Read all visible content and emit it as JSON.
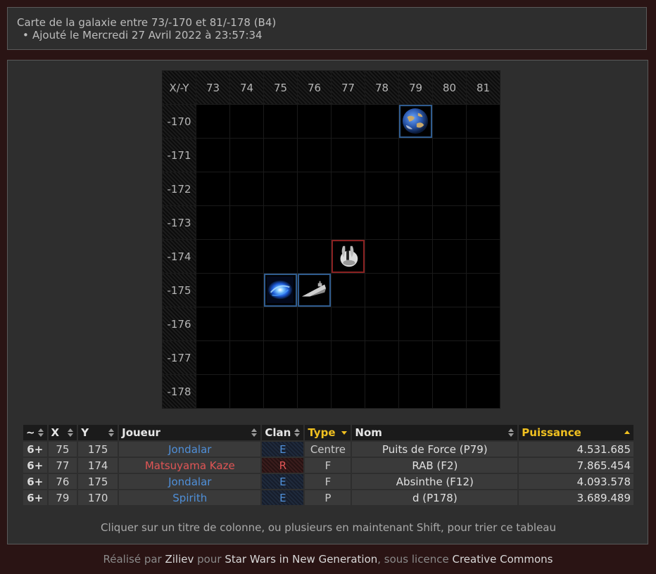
{
  "header": {
    "title": "Carte de la galaxie entre 73/-170 et 81/-178 (B4)",
    "added": "Ajouté le Mercredi 27 Avril 2022 à 23:57:34"
  },
  "map": {
    "corner": "X/-Y",
    "columns": [
      "73",
      "74",
      "75",
      "76",
      "77",
      "78",
      "79",
      "80",
      "81"
    ],
    "rows": [
      "-170",
      "-171",
      "-172",
      "-173",
      "-174",
      "-175",
      "-176",
      "-177",
      "-178"
    ],
    "objects": [
      {
        "x": "79",
        "y": "-170",
        "kind": "planet-icon",
        "frame": "blue"
      },
      {
        "x": "77",
        "y": "-174",
        "kind": "station-icon",
        "frame": "red"
      },
      {
        "x": "75",
        "y": "-175",
        "kind": "nebula-icon",
        "frame": "blue"
      },
      {
        "x": "76",
        "y": "-175",
        "kind": "star-destroyer-icon",
        "frame": "blue"
      }
    ]
  },
  "table": {
    "headers": {
      "rank": "~",
      "x": "X",
      "y": "Y",
      "player": "Joueur",
      "clan": "Clan",
      "type": "Type",
      "name": "Nom",
      "power": "Puissance"
    },
    "rows": [
      {
        "rank": "6+",
        "x": "75",
        "y": "175",
        "player": "Jondalar",
        "player_color": "blue",
        "clan": "E",
        "type": "Centre",
        "name": "Puits de Force (P79)",
        "power": "4.531.685"
      },
      {
        "rank": "6+",
        "x": "77",
        "y": "174",
        "player": "Matsuyama Kaze",
        "player_color": "red",
        "clan": "R",
        "type": "F",
        "name": "RAB (F2)",
        "power": "7.865.454"
      },
      {
        "rank": "6+",
        "x": "76",
        "y": "175",
        "player": "Jondalar",
        "player_color": "blue",
        "clan": "E",
        "type": "F",
        "name": "Absinthe (F12)",
        "power": "4.093.578"
      },
      {
        "rank": "6+",
        "x": "79",
        "y": "170",
        "player": "Spirith",
        "player_color": "blue",
        "clan": "E",
        "type": "P",
        "name": "d (P178)",
        "power": "3.689.489"
      }
    ]
  },
  "hint": "Cliquer sur un titre de colonne, ou plusieurs en maintenant Shift, pour trier ce tableau",
  "footer": {
    "made_by": "Réalisé par",
    "author": "Ziliev",
    "for": "pour",
    "site": "Star Wars in New Generation",
    "license_prefix": ", sous licence",
    "license": "Creative Commons"
  },
  "colors": {
    "blue_player": "#4f8fd8",
    "red_player": "#e05555",
    "active_sort": "#f0c020"
  }
}
